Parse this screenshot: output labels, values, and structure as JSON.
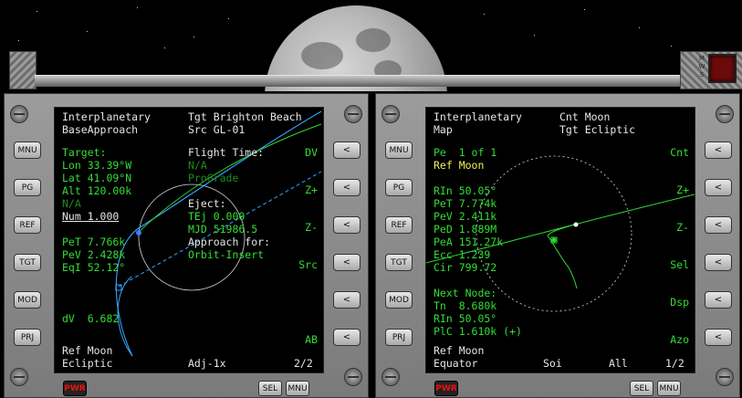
{
  "colors": {
    "text_white": "#e6e6e6",
    "text_green": "#34dd34",
    "text_dim_green": "#1f8a1f",
    "text_yellow": "#f2f25a",
    "trajectory_blue": "#35a6ff",
    "pwr_red": "#e11111"
  },
  "topbar": {
    "mws_label": [
      "M",
      "W",
      "S"
    ]
  },
  "left_mfd": {
    "title1": "Interplanetary",
    "title2": "BaseApproach",
    "tgt": "Tgt Brighton Beach",
    "src": "Src GL-01",
    "target_label": "Target:",
    "lon": "Lon 33.39°W",
    "lat": "Lat 41.09°N",
    "alt": "Alt 120.00k",
    "na1": "N/A",
    "num": "Num 1.000",
    "pet": "PeT 7.766k",
    "pev": "PeV 2.428k",
    "eqi": "EqI 52.12°",
    "dv": "dV  6.682",
    "ref": "Ref Moon",
    "frame": "Ecliptic",
    "flight_time_label": "Flight Time:",
    "na2": "N/A",
    "prograde": "ProGrade",
    "eject_label": "Eject:",
    "tej": "TEj 0.000",
    "mjd": "MJD 51986.5",
    "approach_label": "Approach for:",
    "approach_mode": "Orbit-Insert",
    "adj": "Adj-1x",
    "page": "2/2",
    "right_labels": [
      "DV",
      "Z+",
      "Z-",
      "Src",
      "",
      "AB"
    ],
    "left_buttons": [
      "MNU",
      "PG",
      "REF",
      "TGT",
      "MOD",
      "PRJ"
    ],
    "arrow_label": "<",
    "pwr": "PWR",
    "sel": "SEL",
    "mnu": "MNU"
  },
  "right_mfd": {
    "title1": "Interplanetary",
    "title2": "Map",
    "cnt": "Cnt Moon",
    "tgt": "Tgt Ecliptic",
    "pe": "Pe  1 of 1",
    "ref_moon": "Ref Moon",
    "rin": "RIn 50.05°",
    "pet": "PeT 7.774k",
    "pev": "PeV 2.411k",
    "ped": "PeD 1.889M",
    "pea": "PeA 151.27k",
    "ecc": "Ecc 1.239",
    "cir": "Cir 799.72",
    "next_node_label": "Next Node:",
    "tn": "Tn  8.680k",
    "rin2": "RIn 50.05°",
    "plc": "PlC 1.610k (+)",
    "ref": "Ref Moon",
    "frame": "Equator",
    "soi": "Soi",
    "all": "All",
    "page": "1/2",
    "right_labels": [
      "Cnt",
      "Z+",
      "Z-",
      "Sel",
      "Dsp",
      "Azo"
    ],
    "left_buttons": [
      "MNU",
      "PG",
      "REF",
      "TGT",
      "MOD",
      "PRJ"
    ],
    "arrow_label": "<",
    "pwr": "PWR",
    "sel": "SEL",
    "mnu": "MNU"
  }
}
